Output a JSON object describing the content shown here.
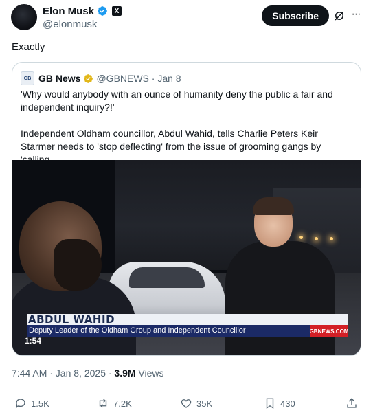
{
  "author": {
    "display_name": "Elon Musk",
    "handle": "@elonmusk"
  },
  "header": {
    "subscribe_label": "Subscribe",
    "more_label": "···"
  },
  "tweet": {
    "text": "Exactly"
  },
  "quote": {
    "logo_text": "GB",
    "name": "GB News",
    "handle_date": "@GBNEWS · Jan 8",
    "paragraph1": "'Why would anybody with an ounce of humanity deny the public a fair and independent inquiry?!'",
    "paragraph2": "Independent Oldham councillor, Abdul Wahid, tells Charlie Peters Keir Starmer needs to 'stop deflecting' from the issue of grooming gangs by 'calling ..."
  },
  "video": {
    "lower_third_name": "ABDUL WAHID",
    "lower_third_role": "Deputy Leader of the Oldham Group and Independent Councillor",
    "channel_tag": "GBNEWS.COM",
    "duration": "1:54"
  },
  "meta": {
    "time_date": "7:44 AM · Jan 8, 2025 · ",
    "views_count": "3.9M",
    "views_label": " Views"
  },
  "actions": {
    "replies": "1.5K",
    "reposts": "7.2K",
    "likes": "35K",
    "bookmarks": "430"
  },
  "colors": {
    "verified_blue": "#1d9bf0",
    "gold_badge": "#e2b719",
    "text_primary": "#0f1419",
    "text_secondary": "#536471"
  }
}
